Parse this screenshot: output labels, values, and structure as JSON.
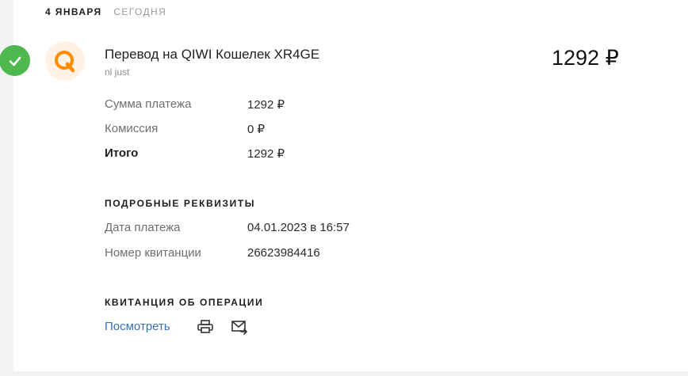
{
  "date_header": {
    "date": "4 ЯНВАРЯ",
    "relative": "СЕГОДНЯ"
  },
  "transaction": {
    "title": "Перевод на QIWI Кошелек XR4GE",
    "subtitle": "nl just",
    "amount": "1292 ₽",
    "status_icon": "check-icon",
    "logo_icon": "qiwi-logo-icon"
  },
  "summary": {
    "rows": [
      {
        "label": "Сумма платежа",
        "value": "1292 ₽"
      },
      {
        "label": "Комиссия",
        "value": "0 ₽"
      },
      {
        "label": "Итого",
        "value": "1292 ₽"
      }
    ]
  },
  "details": {
    "title": "ПОДРОБНЫЕ РЕКВИЗИТЫ",
    "rows": [
      {
        "label": "Дата платежа",
        "value": "04.01.2023 в 16:57"
      },
      {
        "label": "Номер квитанции",
        "value": "26623984416"
      }
    ]
  },
  "receipt": {
    "title": "КВИТАНЦИЯ ОБ ОПЕРАЦИИ",
    "view_label": "Посмотреть",
    "print_icon": "printer-icon",
    "email_icon": "email-forward-icon"
  },
  "colors": {
    "success": "#4cb84e",
    "brand": "#ff8c00",
    "link": "#3a6fb5"
  }
}
